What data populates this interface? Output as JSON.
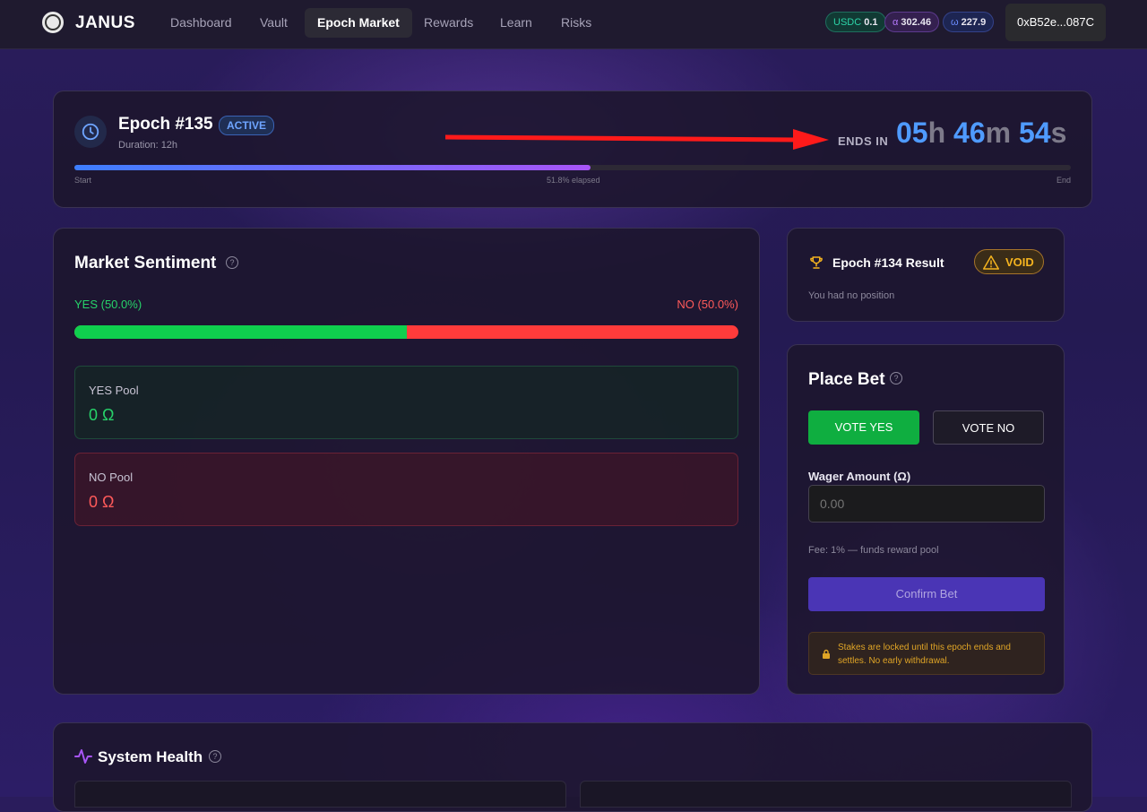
{
  "nav": {
    "brand": "JANUS",
    "tabs": [
      {
        "label": "Dashboard"
      },
      {
        "label": "Vault"
      },
      {
        "label": "Epoch Market"
      },
      {
        "label": "Rewards"
      },
      {
        "label": "Learn"
      },
      {
        "label": "Risks"
      }
    ],
    "active_tab": "Epoch Market",
    "balances": [
      {
        "symbol": "USDC",
        "value": "0.1",
        "color": "#2dd4a8"
      },
      {
        "symbol": "α",
        "value": "302.46",
        "color": "#b77bff"
      },
      {
        "symbol": "ω",
        "value": "227.9",
        "color": "#6b8cff"
      }
    ],
    "wallet": "0xB52e...087C"
  },
  "epoch": {
    "title": "Epoch #135",
    "status": "ACTIVE",
    "duration": "Duration: 12h",
    "ends_label": "ENDS IN",
    "timer": {
      "hours": "05",
      "minutes": "46",
      "seconds": "54",
      "h": "h",
      "m": "m",
      "s": "s"
    },
    "progress_fraction": 0.518,
    "progress_start": "Start",
    "progress_elapsed": "51.8% elapsed",
    "progress_end": "End"
  },
  "sentiment": {
    "title": "Market Sentiment",
    "yes_label": "YES (50.0%)",
    "no_label": "NO (50.0%)",
    "yes_fraction": 0.5,
    "yes_pool_label": "YES Pool",
    "yes_pool_value": "0 Ω",
    "no_pool_label": "NO Pool",
    "no_pool_value": "0 Ω"
  },
  "result": {
    "title": "Epoch #134 Result",
    "badge": "VOID",
    "subtitle": "You had no position"
  },
  "bet": {
    "title": "Place Bet",
    "vote_yes": "VOTE YES",
    "vote_no": "VOTE NO",
    "wager_label": "Wager Amount (Ω)",
    "wager_placeholder": "0.00",
    "fee": "Fee: 1% — funds reward pool",
    "confirm": "Confirm Bet",
    "lock_note": "Stakes are locked until this epoch ends and settles. No early withdrawal."
  },
  "health": {
    "title": "System Health"
  },
  "colors": {
    "accent_blue": "#4f9bff",
    "yes_green": "#0fcf4e",
    "no_red": "#ff3b3b",
    "void_amber": "#f5b41f",
    "annotation_arrow": "#ff1a1a"
  }
}
